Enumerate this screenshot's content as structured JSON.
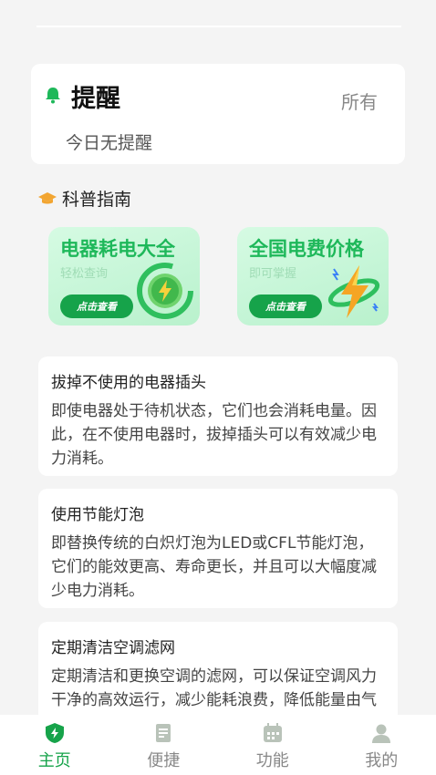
{
  "reminder": {
    "title": "提醒",
    "all_label": "所有",
    "empty_text": "今日无提醒"
  },
  "science": {
    "section_title": "科普指南",
    "cards": [
      {
        "title": "电器耗电大全",
        "subtitle": "轻松查询",
        "button": "点击查看"
      },
      {
        "title": "全国电费价格",
        "subtitle": "即可掌握",
        "button": "点击查看"
      }
    ]
  },
  "tips": [
    {
      "title": "拔掉不使用的电器插头",
      "body": "即使电器处于待机状态，它们也会消耗电量。因此，在不使用电器时，拔掉插头可以有效减少电力消耗。"
    },
    {
      "title": "使用节能灯泡",
      "body": "即替换传统的白炽灯泡为LED或CFL节能灯泡，它们的能效更高、寿命更长，并且可以大幅度减少电力消耗。"
    },
    {
      "title": "定期清洁空调滤网",
      "body": "定期清洁和更换空调的滤网，可以保证空调风力干净的高效运行，减少能耗浪费，降低能量由气流通效率"
    }
  ],
  "tabbar": {
    "items": [
      {
        "label": "主页",
        "icon": "shield-bolt-icon"
      },
      {
        "label": "便捷",
        "icon": "note-icon"
      },
      {
        "label": "功能",
        "icon": "calendar-icon"
      },
      {
        "label": "我的",
        "icon": "person-icon"
      }
    ]
  },
  "colors": {
    "accent": "#16a34a",
    "bell": "#1eb85a",
    "cap": "#f2a531"
  }
}
